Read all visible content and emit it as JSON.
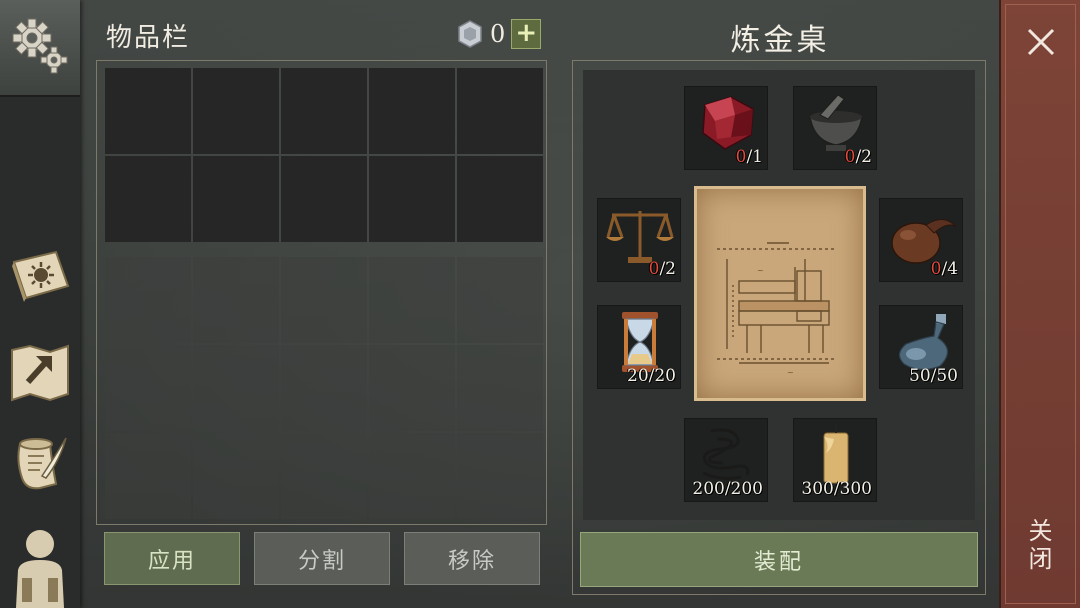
{
  "inventory": {
    "title": "物品栏",
    "currency_value": "0",
    "currency_icon": "silver-gem-icon",
    "plus_label": "+"
  },
  "alchemy": {
    "title": "炼金桌",
    "slots": [
      {
        "name": "red-crystal",
        "have": "0",
        "need": "/1"
      },
      {
        "name": "mortar-pestle",
        "have": "0",
        "need": "/2"
      },
      {
        "name": "scales",
        "have": "0",
        "need": "/2"
      },
      {
        "name": "gourd",
        "have": "0",
        "need": "/4"
      },
      {
        "name": "hourglass",
        "have": "",
        "need": "20/20"
      },
      {
        "name": "glass-flask",
        "have": "",
        "need": "50/50"
      },
      {
        "name": "rope",
        "have": "",
        "need": "200/200"
      },
      {
        "name": "candle",
        "have": "",
        "need": "300/300"
      }
    ]
  },
  "buttons": {
    "apply": "应用",
    "split": "分割",
    "remove": "移除",
    "equip": "装配",
    "close": "关闭"
  },
  "colors": {
    "accent_green": "#6a7a57",
    "close_red": "#7d4437",
    "missing_red": "#e24a3b"
  }
}
